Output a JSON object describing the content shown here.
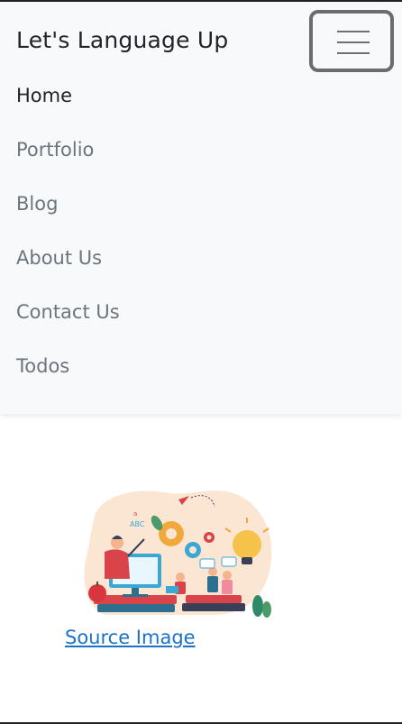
{
  "navbar": {
    "brand": "Let's Language Up",
    "toggle_icon": "hamburger-menu-icon",
    "items": [
      {
        "label": "Home",
        "active": true
      },
      {
        "label": "Portfolio",
        "active": false
      },
      {
        "label": "Blog",
        "active": false
      },
      {
        "label": "About Us",
        "active": false
      },
      {
        "label": "Contact Us",
        "active": false
      },
      {
        "label": "Todos",
        "active": false
      }
    ]
  },
  "main": {
    "illustration_icon": "online-learning-illustration",
    "source_link": "Source Image"
  },
  "colors": {
    "navbar_bg": "#f8f9fa",
    "nav_active": "#1f2327",
    "nav_inactive": "#6c757d",
    "link": "#1a73c9"
  }
}
